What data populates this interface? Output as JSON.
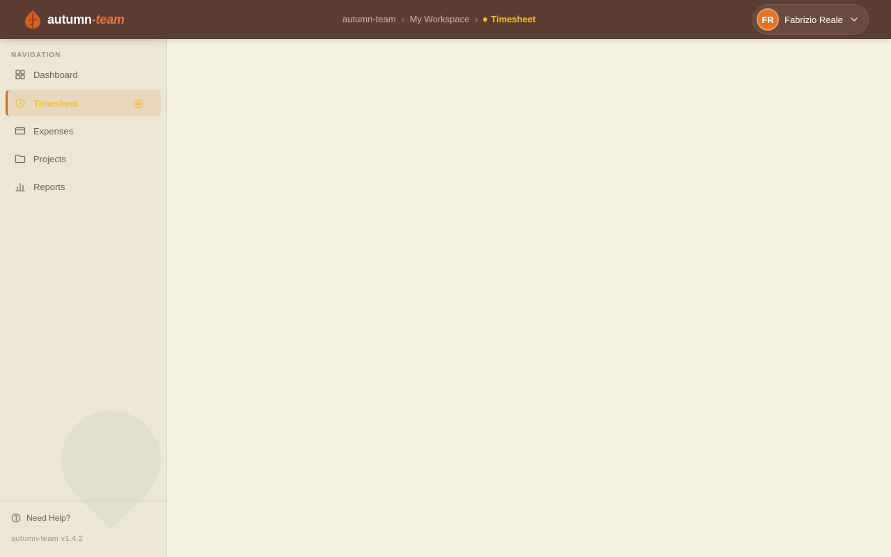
{
  "app": {
    "brand_main": "autumn",
    "brand_accent": "-team",
    "brand_logo": "autumn-leaf-icon"
  },
  "breadcrumb": {
    "items": [
      "autumn-team",
      "My Workspace"
    ],
    "current": "Timesheet"
  },
  "user": {
    "initials": "FR",
    "name": "Fabrizio Reale"
  },
  "sidebar": {
    "heading": "NAVIGATION",
    "items": [
      {
        "label": "Dashboard",
        "icon": "grid-icon"
      },
      {
        "label": "Timesheet",
        "icon": "clock-icon",
        "active": true
      },
      {
        "label": "Expenses",
        "icon": "credit-card-icon"
      },
      {
        "label": "Projects",
        "icon": "folder-icon"
      },
      {
        "label": "Reports",
        "icon": "bar-chart-icon"
      }
    ],
    "help_label": "Need Help?",
    "version": "autumn-team v1.4.2"
  },
  "colors": {
    "topbar": "#5c3d34",
    "accent": "#e8773a",
    "active_text": "#f2c12e",
    "sidebar_bg": "#ebe7d2",
    "main_bg": "#f4f4de"
  }
}
